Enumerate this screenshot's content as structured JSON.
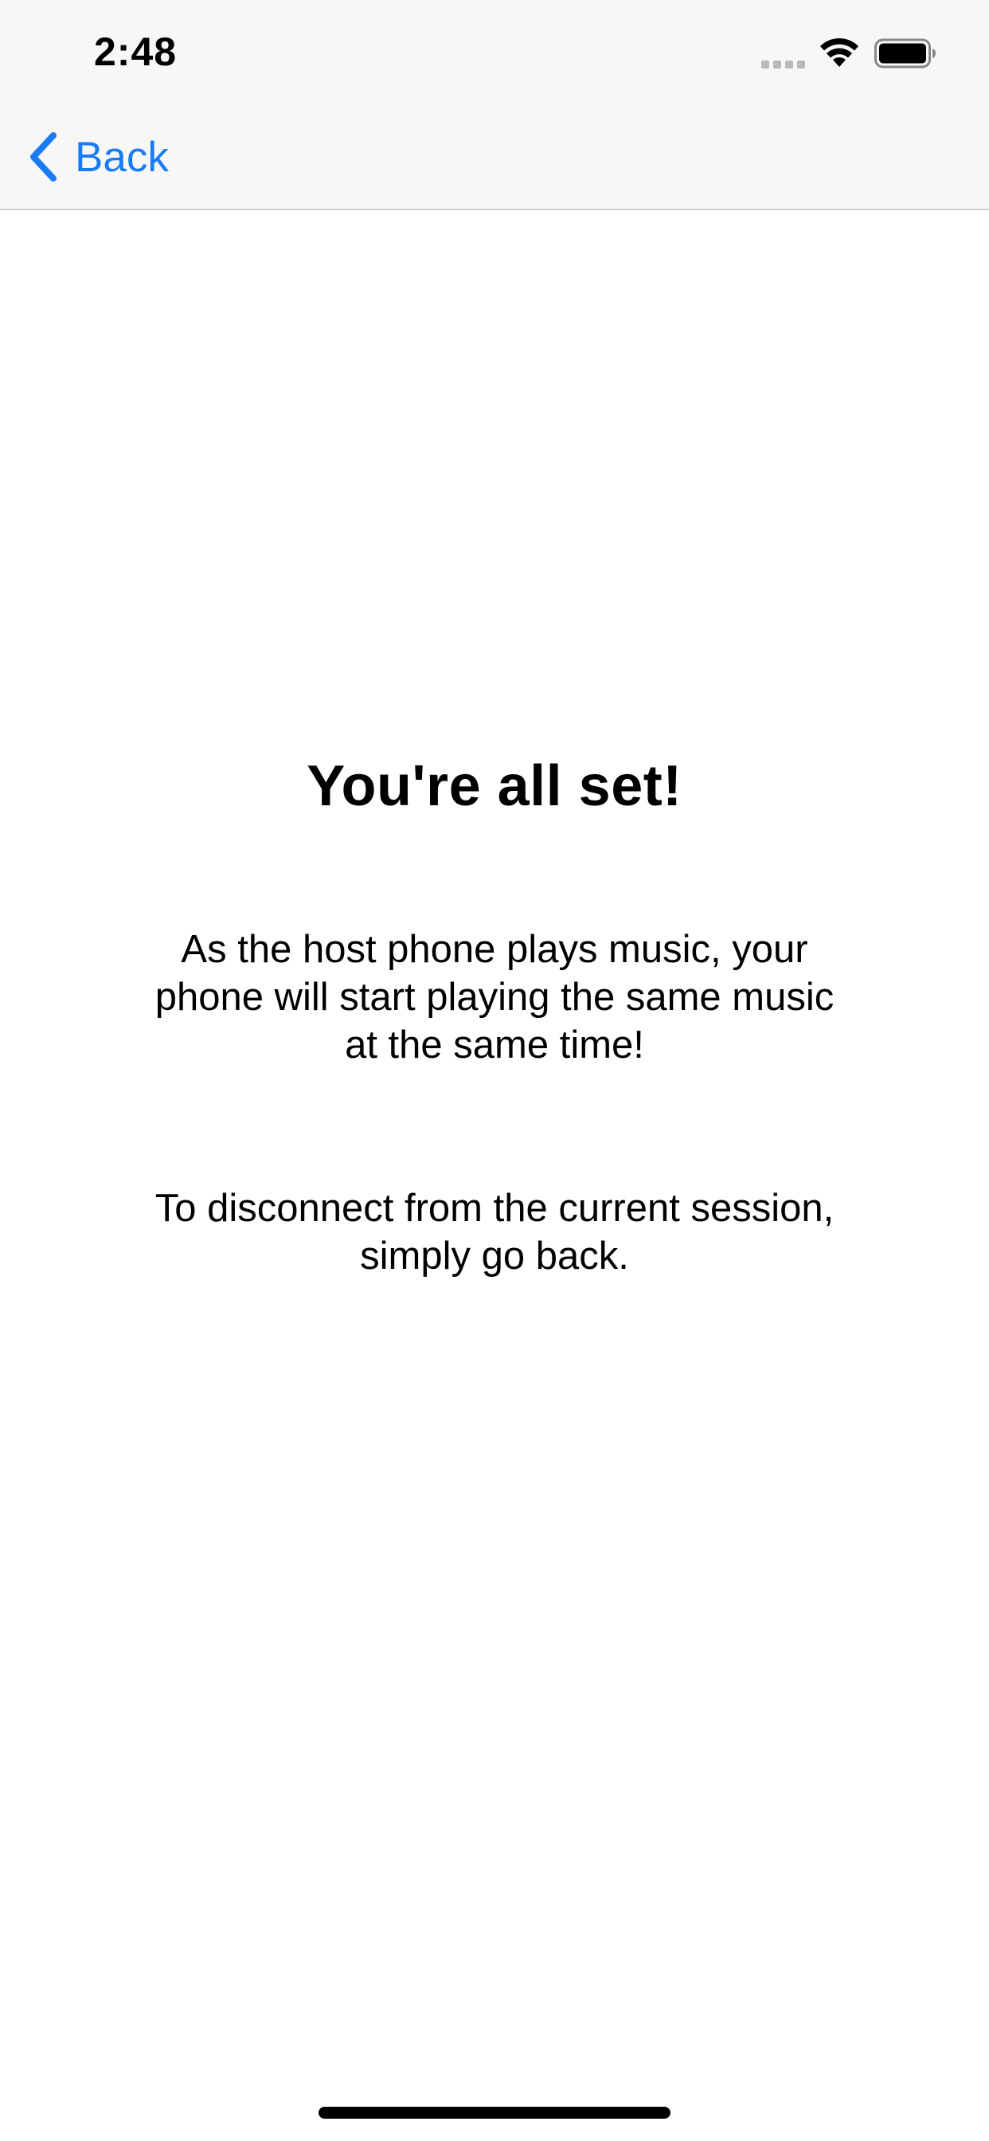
{
  "status_bar": {
    "time": "2:48",
    "signal_icon": "cellular-signal-icon",
    "wifi_icon": "wifi-icon",
    "battery_icon": "battery-icon"
  },
  "nav_bar": {
    "back_label": "Back",
    "back_icon": "chevron-left-icon",
    "accent_color": "#1a7cf5"
  },
  "main": {
    "title": "You're all set!",
    "paragraph_1": "As the host phone plays music, your phone will start playing the same music at the same time!",
    "paragraph_2": "To disconnect from the current session, simply go back."
  }
}
